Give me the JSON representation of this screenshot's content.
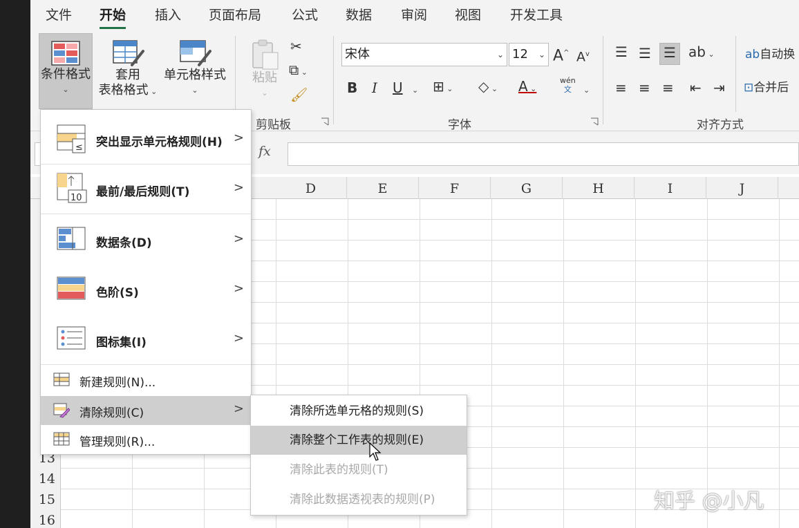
{
  "tabs": [
    "文件",
    "开始",
    "插入",
    "页面布局",
    "公式",
    "数据",
    "审阅",
    "视图",
    "开发工具"
  ],
  "ribbon": {
    "conditional_format": "条件格式",
    "table_format_line1": "套用",
    "table_format_line2": "表格格式",
    "cell_style": "单元格样式",
    "paste": "粘贴",
    "clipboard_group": "剪贴板",
    "font_name": "宋体",
    "font_size": "12",
    "bold": "B",
    "italic": "I",
    "underline": "U",
    "font_color_letter": "A",
    "phonetic_top": "wén",
    "phonetic_bottom": "文",
    "font_group": "字体",
    "align_group": "对齐方式",
    "wrap_text": "自动换",
    "merge": "合并后"
  },
  "formula": {
    "fx": "fx"
  },
  "columns": [
    "D",
    "E",
    "F",
    "G",
    "H",
    "I",
    "J"
  ],
  "rows": [
    "13",
    "14",
    "15",
    "16"
  ],
  "cf_menu": {
    "highlight": "突出显示单元格规则(H)",
    "topbottom": "最前/最后规则(T)",
    "databar": "数据条(D)",
    "colorscale": "色阶(S)",
    "iconset": "图标集(I)",
    "new_rule": "新建规则(N)...",
    "clear_rule": "清除规则(C)",
    "manage_rule": "管理规则(R)...",
    "top10": "10"
  },
  "sub_menu": {
    "clear_selected": "清除所选单元格的规则(S)",
    "clear_sheet": "清除整个工作表的规则(E)",
    "clear_table": "清除此表的规则(T)",
    "clear_pivot": "清除此数据透视表的规则(P)"
  },
  "watermark": "知乎 @小凡"
}
